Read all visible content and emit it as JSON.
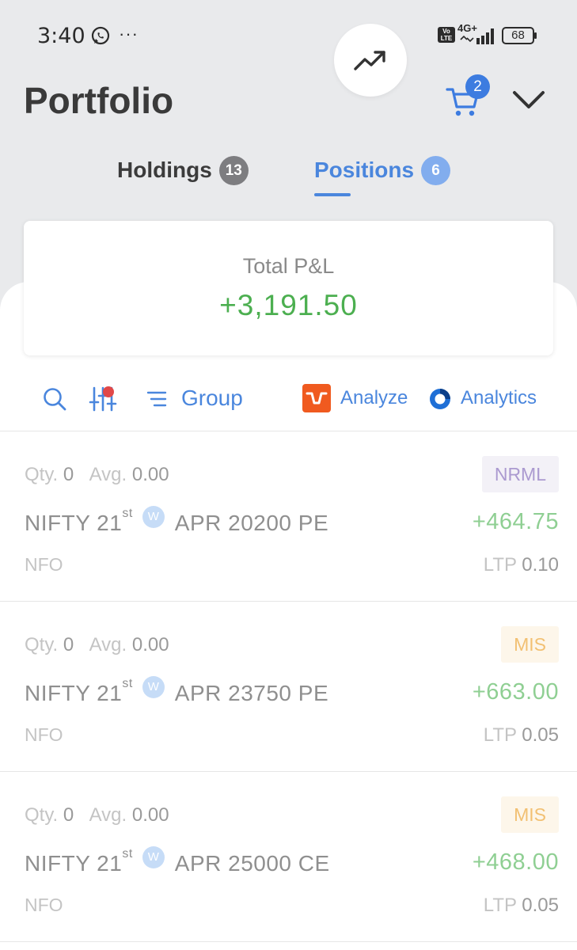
{
  "status_bar": {
    "time": "3:40",
    "dots": "···",
    "volte": "Vo LTE",
    "network": "4G+",
    "battery": "68"
  },
  "header": {
    "title": "Portfolio",
    "cart_count": "2"
  },
  "tabs": [
    {
      "label": "Holdings",
      "count": "13"
    },
    {
      "label": "Positions",
      "count": "6"
    }
  ],
  "pnl_card": {
    "label": "Total P&L",
    "value": "+3,191.50"
  },
  "toolbar": {
    "group_label": "Group",
    "analyze_label": "Analyze",
    "analytics_label": "Analytics"
  },
  "positions": [
    {
      "qty_label": "Qty.",
      "qty": "0",
      "avg_label": "Avg.",
      "avg": "0.00",
      "product": "NRML",
      "symbol_prefix": "NIFTY 21",
      "symbol_sup": "st",
      "weekly": "W",
      "symbol_suffix": "APR 20200 PE",
      "pnl": "+464.75",
      "exchange": "NFO",
      "ltp_label": "LTP",
      "ltp": "0.10"
    },
    {
      "qty_label": "Qty.",
      "qty": "0",
      "avg_label": "Avg.",
      "avg": "0.00",
      "product": "MIS",
      "symbol_prefix": "NIFTY 21",
      "symbol_sup": "st",
      "weekly": "W",
      "symbol_suffix": "APR 23750 PE",
      "pnl": "+663.00",
      "exchange": "NFO",
      "ltp_label": "LTP",
      "ltp": "0.05"
    },
    {
      "qty_label": "Qty.",
      "qty": "0",
      "avg_label": "Avg.",
      "avg": "0.00",
      "product": "MIS",
      "symbol_prefix": "NIFTY 21",
      "symbol_sup": "st",
      "weekly": "W",
      "symbol_suffix": "APR 25000 CE",
      "pnl": "+468.00",
      "exchange": "NFO",
      "ltp_label": "LTP",
      "ltp": "0.05"
    }
  ],
  "colors": {
    "accent": "#4a86dd",
    "profit": "#4caf50",
    "analyze_brand": "#f05a1f"
  },
  "icons": [
    "whatsapp-icon",
    "signal-icon",
    "battery-icon",
    "trend-up-icon",
    "cart-icon",
    "chevron-down-icon",
    "search-icon",
    "filter-icon",
    "group-icon",
    "analyze-logo-icon",
    "analytics-logo-icon"
  ]
}
